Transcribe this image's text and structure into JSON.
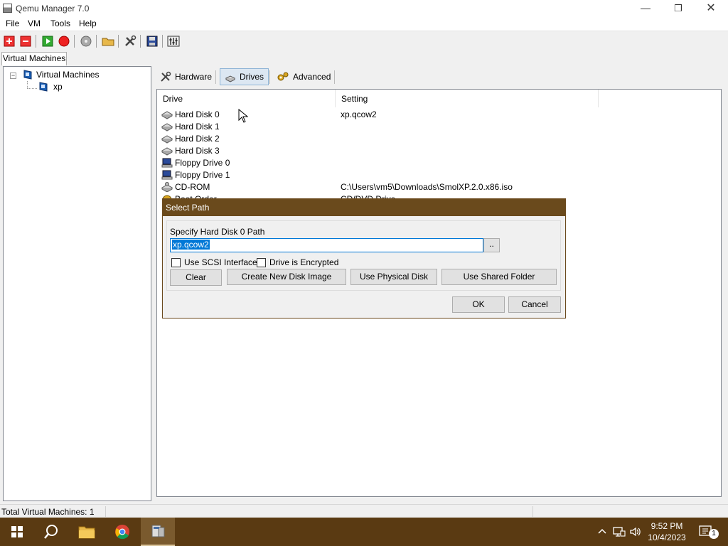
{
  "window": {
    "title": "Qemu Manager 7.0",
    "minimize_icon": "minimize-icon",
    "maximize_icon": "restore-icon",
    "close_icon": "close-icon"
  },
  "menu": [
    "File",
    "VM",
    "Tools",
    "Help"
  ],
  "toolbar": {
    "icons": [
      "add-vm-icon",
      "remove-vm-icon",
      "start-vm-icon",
      "stop-vm-icon",
      "disc-icon",
      "open-folder-icon",
      "settings-icon",
      "save-icon",
      "console-icon"
    ]
  },
  "left": {
    "tab_label": "Virtual Machines",
    "tree_root": "Virtual Machines",
    "tree_child": "xp",
    "expander": "−"
  },
  "tabs": [
    {
      "label": "Hardware",
      "icon": "tools-icon"
    },
    {
      "label": "Drives",
      "icon": "drive-icon"
    },
    {
      "label": "Advanced",
      "icon": "gears-icon"
    }
  ],
  "listview": {
    "columns": [
      "Drive",
      "Setting"
    ],
    "rows": [
      {
        "drive": "Hard Disk 0",
        "setting": "xp.qcow2",
        "icon": "hard-disk-icon"
      },
      {
        "drive": "Hard Disk 1",
        "setting": "",
        "icon": "hard-disk-icon"
      },
      {
        "drive": "Hard Disk 2",
        "setting": "",
        "icon": "hard-disk-icon"
      },
      {
        "drive": "Hard Disk 3",
        "setting": "",
        "icon": "hard-disk-icon"
      },
      {
        "drive": "Floppy Drive 0",
        "setting": "",
        "icon": "floppy-icon"
      },
      {
        "drive": "Floppy Drive 1",
        "setting": "",
        "icon": "floppy-icon"
      },
      {
        "drive": "CD-ROM",
        "setting": "C:\\Users\\vm5\\Downloads\\SmolXP.2.0.x86.iso",
        "icon": "cdrom-icon"
      },
      {
        "drive": "Boot Order",
        "setting": "CD/DVD Drive",
        "icon": "boot-icon"
      }
    ]
  },
  "dialog": {
    "title": "Select Path",
    "label": "Specify Hard Disk 0 Path",
    "path_value": "xp.qcow2",
    "browse_label": "..",
    "use_scsi_label": "Use SCSI Interface",
    "encrypted_label": "Drive is Encrypted",
    "use_scsi_checked": false,
    "encrypted_checked": false,
    "buttons": {
      "clear": "Clear",
      "create": "Create New Disk Image",
      "physical": "Use Physical Disk",
      "shared": "Use Shared Folder",
      "ok": "OK",
      "cancel": "Cancel"
    }
  },
  "status": {
    "text": "Total Virtual Machines: 1"
  },
  "taskbar": {
    "apps": [
      "windows-start-icon",
      "search-icon",
      "file-explorer-icon",
      "chrome-icon",
      "qemu-manager-icon"
    ],
    "time": "9:52 PM",
    "date": "10/4/2023",
    "notification_count": "1"
  },
  "colors": {
    "dialog_title": "#6a4a1c",
    "taskbar": "#5a3a12",
    "selection": "#0078d7"
  }
}
